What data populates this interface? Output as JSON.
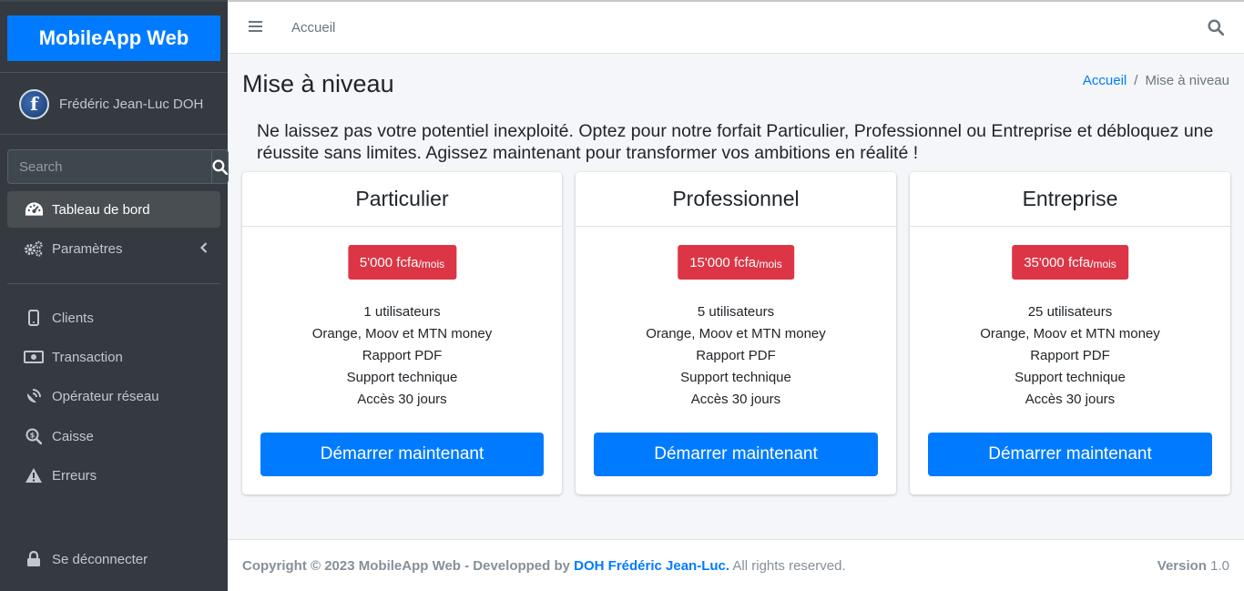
{
  "app": {
    "brand": "MobileApp Web"
  },
  "user": {
    "name": "Frédéric Jean-Luc DOH",
    "avatar_letter": "f"
  },
  "sidebar": {
    "search_placeholder": "Search",
    "items": [
      {
        "label": "Tableau de bord",
        "icon": "tachometer-icon"
      },
      {
        "label": "Paramètres",
        "icon": "cogs-icon"
      },
      {
        "label": "Clients",
        "icon": "mobile-icon"
      },
      {
        "label": "Transaction",
        "icon": "money-bill-icon"
      },
      {
        "label": "Opérateur réseau",
        "icon": "satellite-dish-icon"
      },
      {
        "label": "Caisse",
        "icon": "search-dollar-icon"
      },
      {
        "label": "Erreurs",
        "icon": "warning-icon"
      },
      {
        "label": "Se déconnecter",
        "icon": "lock-icon"
      }
    ]
  },
  "topbar": {
    "home_link": "Accueil"
  },
  "page": {
    "title": "Mise à niveau",
    "breadcrumb": {
      "home": "Accueil",
      "separator": "/",
      "current": "Mise à niveau"
    },
    "intro": "Ne laissez pas votre potentiel inexploité. Optez pour notre forfait Particulier, Professionnel ou Entreprise et débloquez une réussite sans limites. Agissez maintenant pour transformer vos ambitions en réalité !"
  },
  "plans": [
    {
      "name": "Particulier",
      "price": "5'000 fcfa",
      "period": "/mois",
      "features": [
        "1 utilisateurs",
        "Orange, Moov et MTN money",
        "Rapport PDF",
        "Support technique",
        "Accès 30 jours"
      ],
      "cta": "Démarrer maintenant"
    },
    {
      "name": "Professionnel",
      "price": "15'000 fcfa",
      "period": "/mois",
      "features": [
        "5 utilisateurs",
        "Orange, Moov et MTN money",
        "Rapport PDF",
        "Support technique",
        "Accès 30 jours"
      ],
      "cta": "Démarrer maintenant"
    },
    {
      "name": "Entreprise",
      "price": "35'000 fcfa",
      "period": "/mois",
      "features": [
        "25 utilisateurs",
        "Orange, Moov et MTN money",
        "Rapport PDF",
        "Support technique",
        "Accès 30 jours"
      ],
      "cta": "Démarrer maintenant"
    }
  ],
  "footer": {
    "copyright": "Copyright © 2023 MobileApp Web - Developped by",
    "author": "DOH Frédéric Jean-Luc.",
    "rights": "All rights reserved.",
    "version_label": "Version",
    "version": "1.0"
  },
  "colors": {
    "primary": "#007bff",
    "danger": "#dc3545",
    "sidebar": "#343a40"
  }
}
